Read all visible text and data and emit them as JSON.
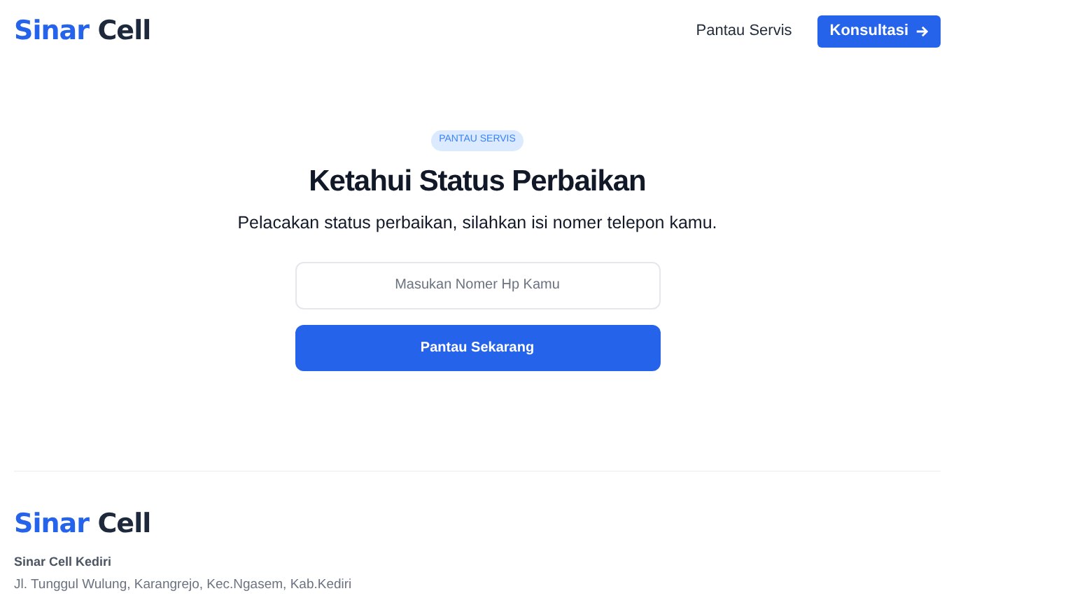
{
  "header": {
    "logo": {
      "primary": "Sinar",
      "secondary": "Cell"
    },
    "nav_link": "Pantau Servis",
    "cta_button": "Konsultasi"
  },
  "hero": {
    "badge": "PANTAU SERVIS",
    "title": "Ketahui Status Perbaikan",
    "subtitle": "Pelacakan status perbaikan, silahkan isi nomer telepon kamu.",
    "phone_field": {
      "placeholder": "Masukan Nomer Hp Kamu"
    },
    "submit_button": "Pantau Sekarang"
  },
  "footer": {
    "logo": {
      "primary": "Sinar",
      "secondary": "Cell"
    },
    "company": "Sinar Cell Kediri",
    "address": "Jl. Tunggul Wulung, Karangrejo, Kec.Ngasem, Kab.Kediri"
  }
}
